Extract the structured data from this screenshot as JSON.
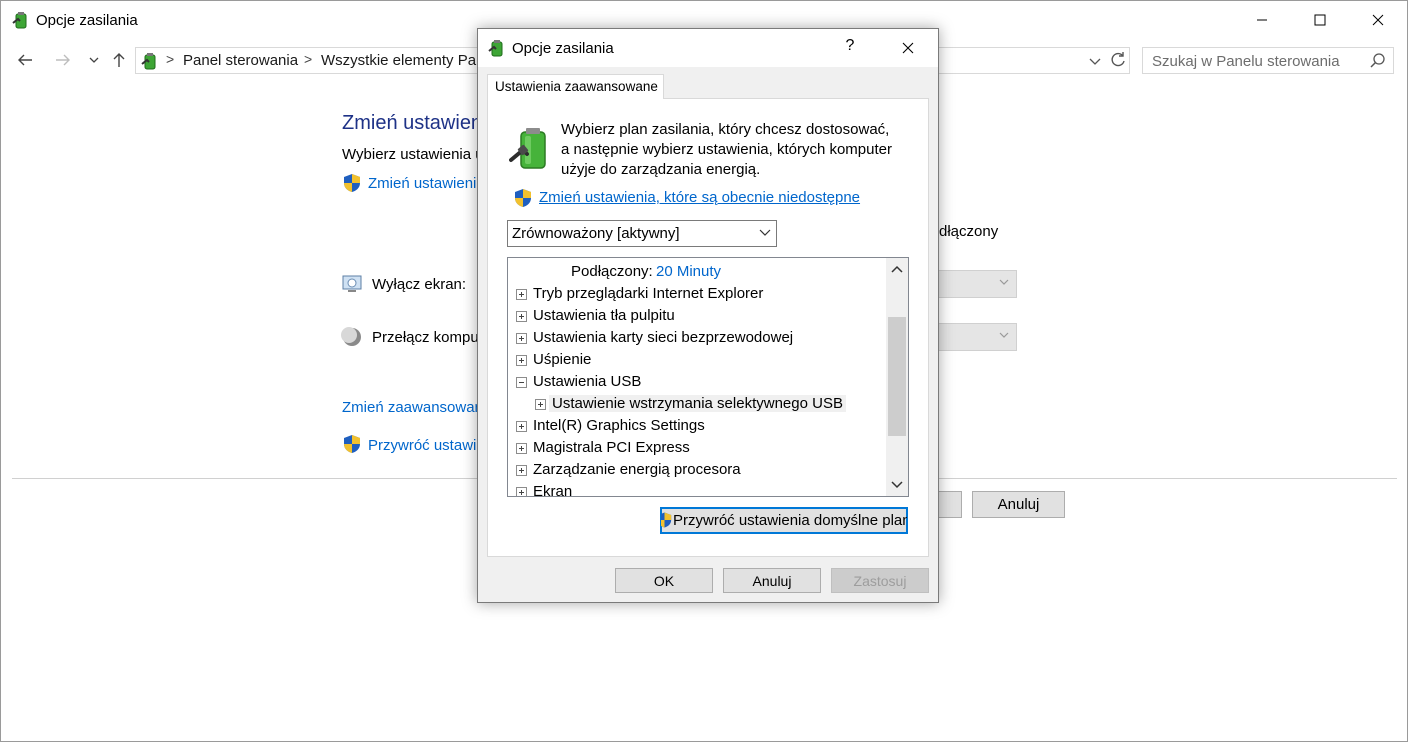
{
  "window": {
    "title": "Opcje zasilania",
    "controls": {
      "minimize": "minimize-icon",
      "maximize": "maximize-icon",
      "close": "close-icon"
    }
  },
  "nav": {
    "breadcrumbs": [
      "Panel sterowania",
      "Wszystkie elementy Pane"
    ],
    "search_placeholder": "Szukaj w Panelu sterowania"
  },
  "background": {
    "heading": "Zmień ustawieni",
    "subtitle": "Wybierz ustawienia u",
    "change_link": "Zmień ustawienia",
    "plugged_in_header": "dłączony",
    "turn_off_display_label": "Wyłącz ekran:",
    "sleep_label": "Przełącz komput",
    "advanced_link": "Zmień zaawansowan",
    "restore_link": "Przywróć ustawie",
    "cancel_button": "Anuluj"
  },
  "dialog": {
    "title": "Opcje zasilania",
    "help": "?",
    "tab": "Ustawienia zaawansowane",
    "intro_lines": [
      "Wybierz plan zasilania, który chcesz dostosować,",
      "a następnie wybierz ustawienia, których komputer",
      "użyje do zarządzania energią."
    ],
    "unavailable_link": "Zmień ustawienia, które są obecnie niedostępne",
    "plan_selected": "Zrównoważony [aktywny]",
    "tree": {
      "value_label": "Podłączony:",
      "value": "20 Minuty",
      "items": [
        "Tryb przeglądarki Internet Explorer",
        "Ustawienia tła pulpitu",
        "Ustawienia karty sieci bezprzewodowej",
        "Uśpienie",
        "Ustawienia USB",
        "Ustawienie wstrzymania selektywnego USB",
        "Intel(R) Graphics Settings",
        "Magistrala PCI Express",
        "Zarządzanie energią procesora",
        "Ekran"
      ]
    },
    "restore_button": "Przywróć ustawienia domyślne plan",
    "ok_button": "OK",
    "cancel_button": "Anuluj",
    "apply_button": "Zastosuj"
  }
}
